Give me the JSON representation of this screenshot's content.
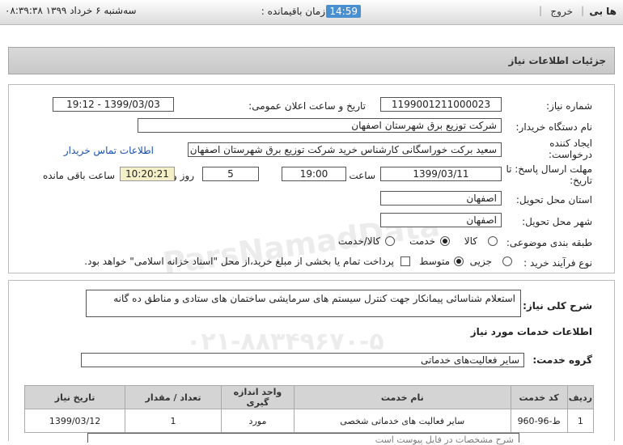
{
  "topbar": {
    "user": "ها بی",
    "logout": "خروج",
    "remaining_label": "زمان باقیمانده :",
    "timer": "14:59",
    "datetime": "سه‌شنبه ۶ خرداد ۱۳۹۹  ۰۸:۳۹:۳۸"
  },
  "header": {
    "title": "جزئیات اطلاعات نیاز"
  },
  "form": {
    "need_number_label": "شماره نیاز:",
    "need_number": "1199001211000023",
    "announce_label": "تاریخ و ساعت اعلان عمومی:",
    "announce_value": "1399/03/03 - 19:12",
    "buyer_org_label": "نام دستگاه خریدار:",
    "buyer_org": "شرکت توزیع برق شهرستان اصفهان",
    "creator_label": "ایجاد کننده درخواست:",
    "creator": "سعید برکت خوراسگانی کارشناس خرید شرکت توزیع برق شهرستان اصفهان",
    "contact_link": "اطلاعات تماس خریدار",
    "deadline_label": "مهلت ارسال پاسخ: تا تاریخ:",
    "deadline_date": "1399/03/11",
    "time_label": "ساعت",
    "deadline_time": "19:00",
    "days": "5",
    "days_label": "روز و",
    "remaining_time": "10:20:21",
    "remaining_label": "ساعت باقی مانده",
    "province_label": "استان محل تحویل:",
    "province": "اصفهان",
    "city_label": "شهر محل تحویل:",
    "city": "اصفهان",
    "category_label": "طبقه بندی موضوعی:",
    "category_options": [
      "کالا",
      "خدمت",
      "کالا/خدمت"
    ],
    "category_selected": "خدمت",
    "process_label": "نوع فرآیند خرید :",
    "process_options": [
      "جزیی",
      "متوسط"
    ],
    "process_selected": "متوسط",
    "payment_note": "پرداخت تمام یا بخشی از مبلغ خرید،از محل \"اسناد خزانه اسلامی\" خواهد بود."
  },
  "need": {
    "desc_label": "شرح کلی نیاز:",
    "desc": "استعلام شناسائی پیمانکار جهت کنترل سیستم های سرمایشی ساختمان های ستادی و مناطق ده گانه",
    "services_title": "اطلاعات خدمات مورد نیاز",
    "group_label": "گروه خدمت:",
    "group": "سایر فعالیت‌های خدماتی"
  },
  "table": {
    "headers": [
      "ردیف",
      "کد خدمت",
      "نام خدمت",
      "واحد اندازه گیری",
      "تعداد / مقدار",
      "تاریخ نیاز"
    ],
    "rows": [
      [
        "1",
        "ط-96-960",
        "سایر فعالیت های خدماتی شخصی",
        "مورد",
        "1",
        "1399/03/12"
      ]
    ]
  },
  "bottom_text": "شرح مشخصات در فایل پیوست است"
}
